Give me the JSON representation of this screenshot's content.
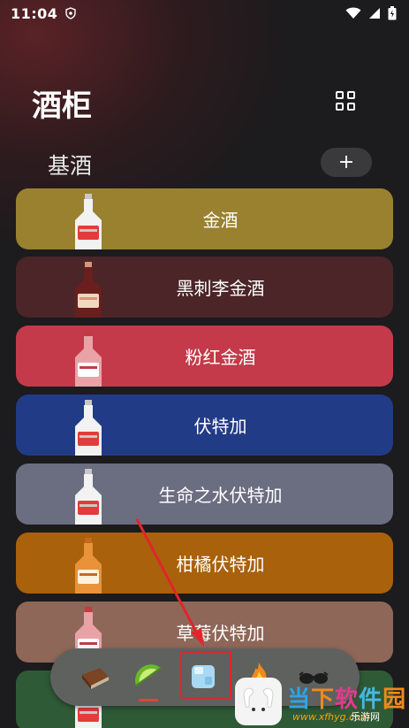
{
  "status_bar": {
    "time": "11:04"
  },
  "header": {
    "title": "酒柜"
  },
  "section": {
    "title": "基酒",
    "add_label": "+"
  },
  "spirits": [
    {
      "name": "金酒",
      "color": "#99812f",
      "bottle": "clear"
    },
    {
      "name": "黑刺李金酒",
      "color": "#4b2527",
      "bottle": "dark-red"
    },
    {
      "name": "粉红金酒",
      "color": "#c43a4a",
      "bottle": "pink"
    },
    {
      "name": "伏特加",
      "color": "#213b86",
      "bottle": "clear"
    },
    {
      "name": "生命之水伏特加",
      "color": "#6b6d80",
      "bottle": "clear"
    },
    {
      "name": "柑橘伏特加",
      "color": "#a9610c",
      "bottle": "orange"
    },
    {
      "name": "草莓伏特加",
      "color": "#8e6758",
      "bottle": "pink"
    },
    {
      "name": "",
      "color": "#2f5a36",
      "bottle": "clear"
    }
  ],
  "tabbar": {
    "tabs": [
      {
        "icon": "book-icon"
      },
      {
        "icon": "lime-icon"
      },
      {
        "icon": "ice-cube-icon",
        "selected": true
      },
      {
        "icon": "fire-icon"
      },
      {
        "icon": "sunglasses-icon"
      }
    ]
  },
  "watermark": {
    "text": "当下软件园",
    "sub": "www.xfhyg.com",
    "tag": "乐游网"
  }
}
